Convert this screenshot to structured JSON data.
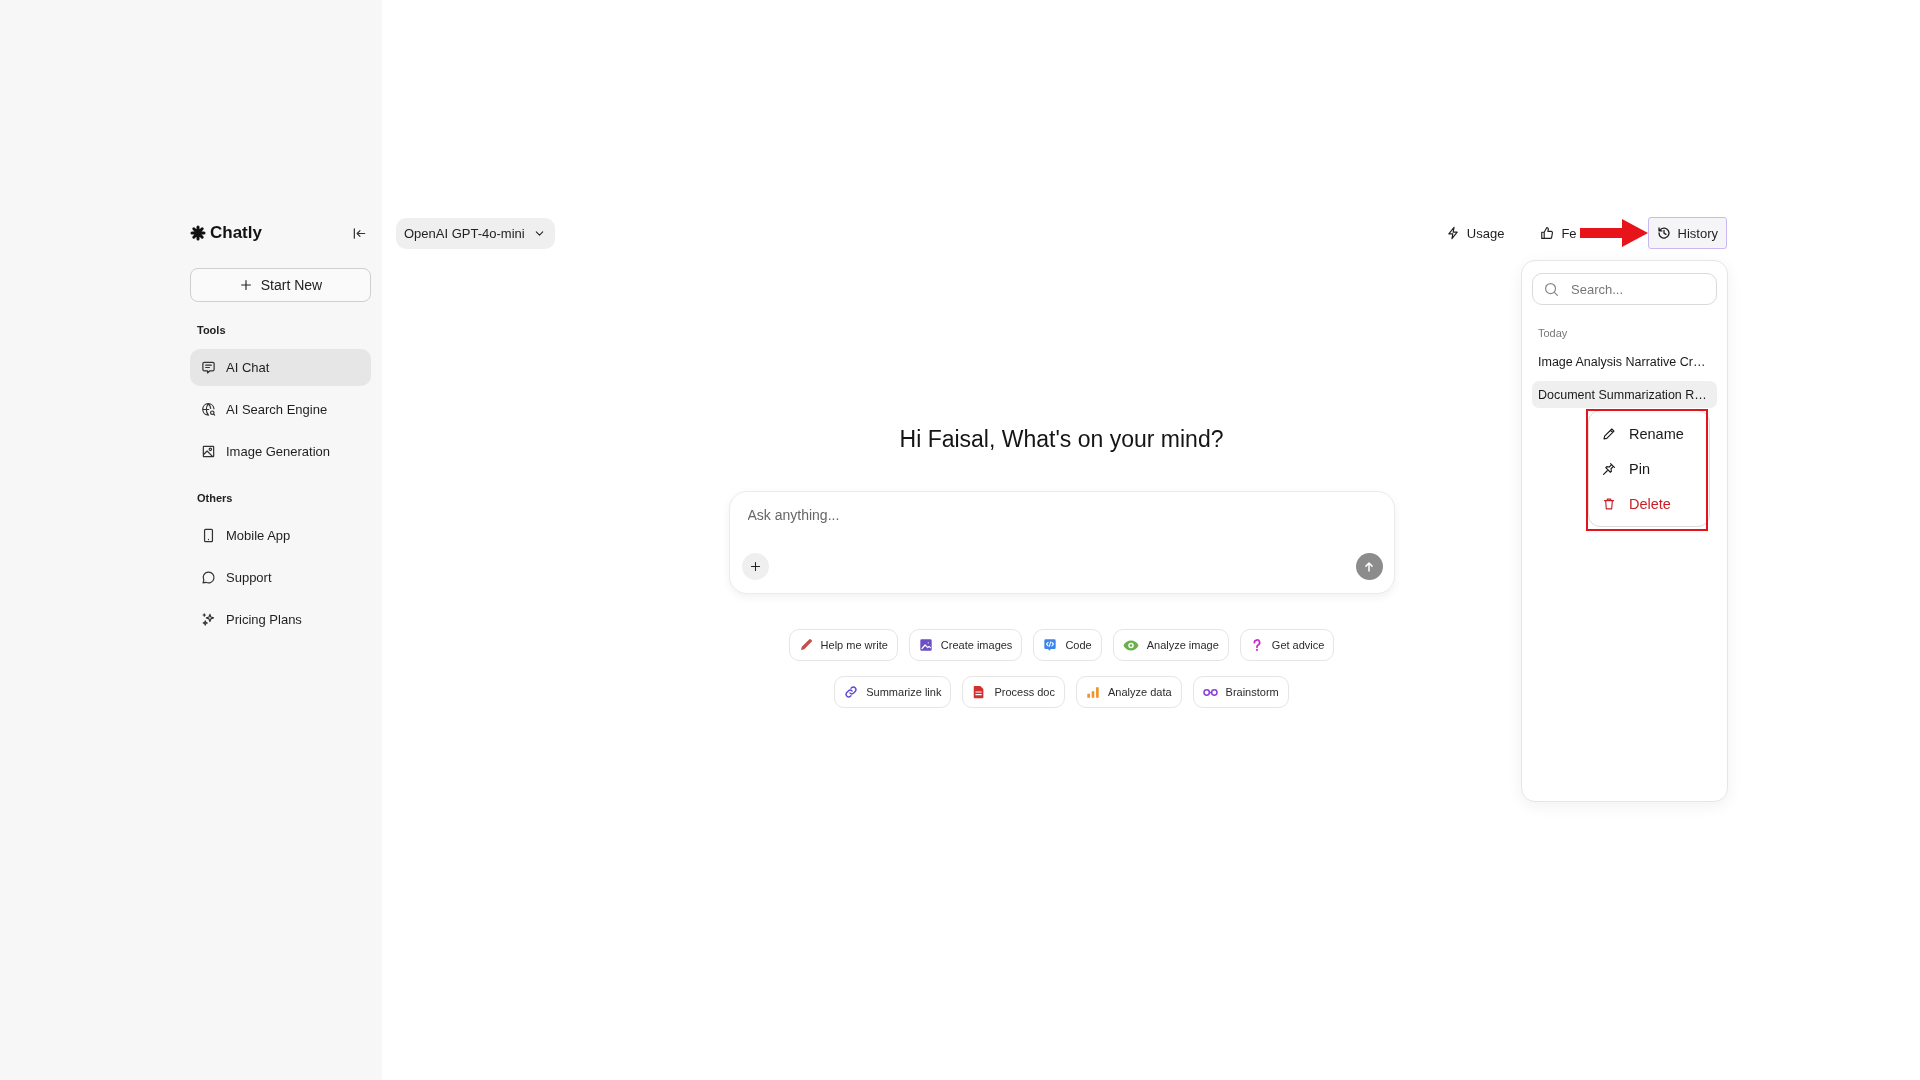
{
  "sidebar": {
    "brand": "Chatly",
    "start_button": "Start New",
    "sections": [
      {
        "title": "Tools",
        "items": [
          {
            "label": "AI Chat",
            "selected": true
          },
          {
            "label": "AI Search Engine",
            "selected": false
          },
          {
            "label": "Image Generation",
            "selected": false
          }
        ]
      },
      {
        "title": "Others",
        "items": [
          {
            "label": "Mobile App",
            "selected": false
          },
          {
            "label": "Support",
            "selected": false
          },
          {
            "label": "Pricing Plans",
            "selected": false
          }
        ]
      }
    ]
  },
  "header": {
    "model_selector": "OpenAI GPT-4o-mini",
    "actions": [
      {
        "label": "Usage",
        "selected": false,
        "pointed_at": false
      },
      {
        "label": "Fe",
        "selected": false,
        "pointed_at": false
      },
      {
        "label": "History",
        "selected": true,
        "pointed_at": true
      }
    ]
  },
  "history_panel": {
    "search": {
      "placeholder": "Search..."
    },
    "groups": [
      {
        "title": "Today",
        "items": [
          {
            "title": "Image Analysis Narrative Cr…",
            "selected": false
          },
          {
            "title": "Document Summarization R…",
            "selected": true
          }
        ]
      }
    ],
    "context_menu": {
      "highlighted": true,
      "items": [
        {
          "label": "Rename",
          "kind": "action"
        },
        {
          "label": "Pin",
          "kind": "action"
        },
        {
          "label": "Delete",
          "kind": "danger"
        }
      ]
    }
  },
  "greeting": "Hi Faisal, What's on your mind?",
  "composer": {
    "placeholder": "Ask anything..."
  },
  "suggestion_rows": [
    {
      "chips": [
        {
          "label": "Help me write"
        },
        {
          "label": "Create images"
        },
        {
          "label": "Code"
        },
        {
          "label": "Analyze image"
        },
        {
          "label": "Get advice"
        }
      ]
    },
    {
      "chips": [
        {
          "label": "Summarize link"
        },
        {
          "label": "Process doc"
        },
        {
          "label": "Analyze data"
        },
        {
          "label": "Brainstorm"
        }
      ]
    }
  ]
}
